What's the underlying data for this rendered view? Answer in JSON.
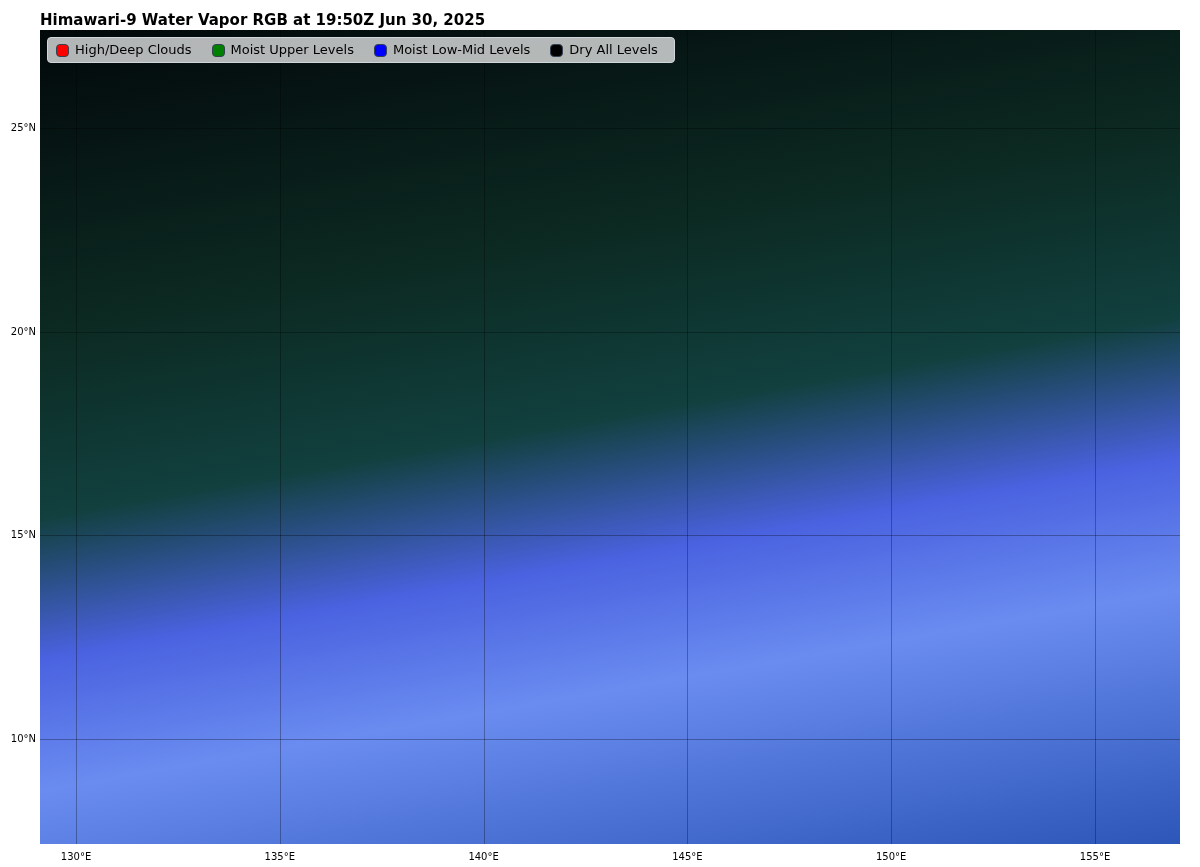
{
  "title": "Himawari-9 Water Vapor RGB at 19:50Z Jun 30, 2025",
  "legend": [
    {
      "label": "High/Deep Clouds",
      "color": "#ff0000"
    },
    {
      "label": "Moist Upper Levels",
      "color": "#008000"
    },
    {
      "label": "Moist Low-Mid Levels",
      "color": "#0000ff"
    },
    {
      "label": "Dry All Levels",
      "color": "#000000"
    }
  ],
  "map": {
    "lat_labels": [
      "25°N",
      "20°N",
      "15°N",
      "10°N"
    ],
    "lon_labels": [
      "130°E",
      "135°E",
      "140°E",
      "145°E",
      "150°E",
      "155°E"
    ]
  }
}
